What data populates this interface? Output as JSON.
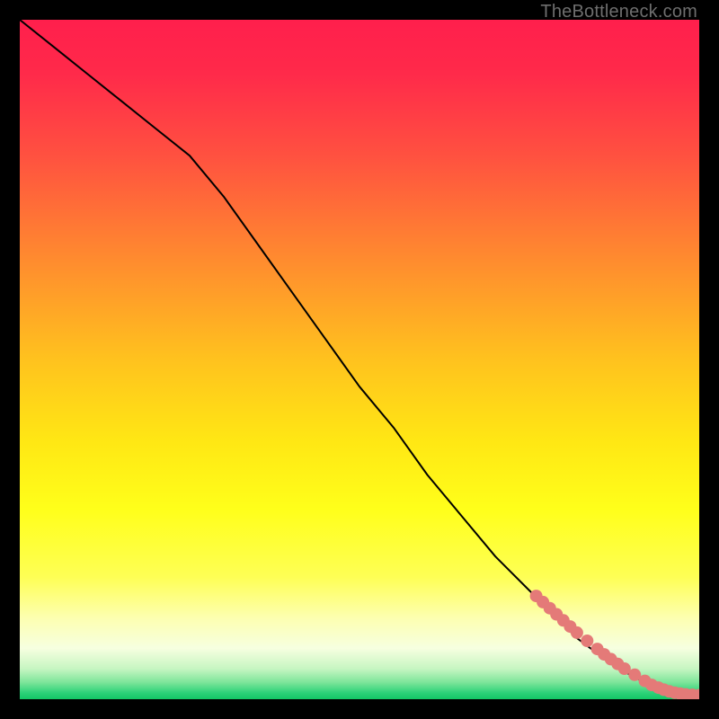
{
  "watermark": "TheBottleneck.com",
  "chart_data": {
    "type": "line",
    "title": "",
    "xlabel": "",
    "ylabel": "",
    "xlim": [
      0,
      100
    ],
    "ylim": [
      0,
      100
    ],
    "grid": false,
    "legend": false,
    "series": [
      {
        "name": "curve",
        "stroke": "#000000",
        "stroke_width": 2,
        "x": [
          0,
          5,
          10,
          15,
          20,
          25,
          30,
          35,
          40,
          45,
          50,
          55,
          60,
          65,
          70,
          75,
          80,
          82,
          84,
          86,
          88,
          90,
          92,
          94,
          96,
          98,
          100
        ],
        "y": [
          100,
          96,
          92,
          88,
          84,
          80,
          74,
          67,
          60,
          53,
          46,
          40,
          33,
          27,
          21,
          16,
          11,
          9,
          7.5,
          6,
          4.7,
          3.5,
          2.5,
          1.7,
          1.1,
          0.8,
          0.6
        ]
      }
    ],
    "markers": [
      {
        "name": "highlight-segment",
        "color": "#e47a78",
        "radius_px": 7,
        "x": [
          76,
          77,
          78,
          79,
          80,
          81,
          82,
          83.5,
          85,
          86,
          87,
          88,
          89,
          90.5,
          92,
          93,
          94,
          94.8,
          95.6,
          96.4,
          97.2,
          98,
          99,
          100
        ],
        "y": [
          15.2,
          14.3,
          13.4,
          12.5,
          11.6,
          10.7,
          9.8,
          8.6,
          7.4,
          6.6,
          5.9,
          5.2,
          4.5,
          3.6,
          2.7,
          2.1,
          1.7,
          1.4,
          1.15,
          0.95,
          0.82,
          0.72,
          0.65,
          0.6
        ]
      }
    ],
    "background": {
      "type": "vertical-gradient",
      "stops": [
        {
          "pos": 0.0,
          "color": "#ff1f4c"
        },
        {
          "pos": 0.08,
          "color": "#ff2a4a"
        },
        {
          "pos": 0.2,
          "color": "#ff5140"
        },
        {
          "pos": 0.35,
          "color": "#ff8a2f"
        },
        {
          "pos": 0.5,
          "color": "#ffc21e"
        },
        {
          "pos": 0.62,
          "color": "#ffe714"
        },
        {
          "pos": 0.72,
          "color": "#ffff1a"
        },
        {
          "pos": 0.82,
          "color": "#feff55"
        },
        {
          "pos": 0.88,
          "color": "#fdffb0"
        },
        {
          "pos": 0.925,
          "color": "#f6ffe0"
        },
        {
          "pos": 0.955,
          "color": "#c7f6c2"
        },
        {
          "pos": 0.975,
          "color": "#7ee59a"
        },
        {
          "pos": 0.99,
          "color": "#2fd37a"
        },
        {
          "pos": 1.0,
          "color": "#13c765"
        }
      ]
    }
  }
}
